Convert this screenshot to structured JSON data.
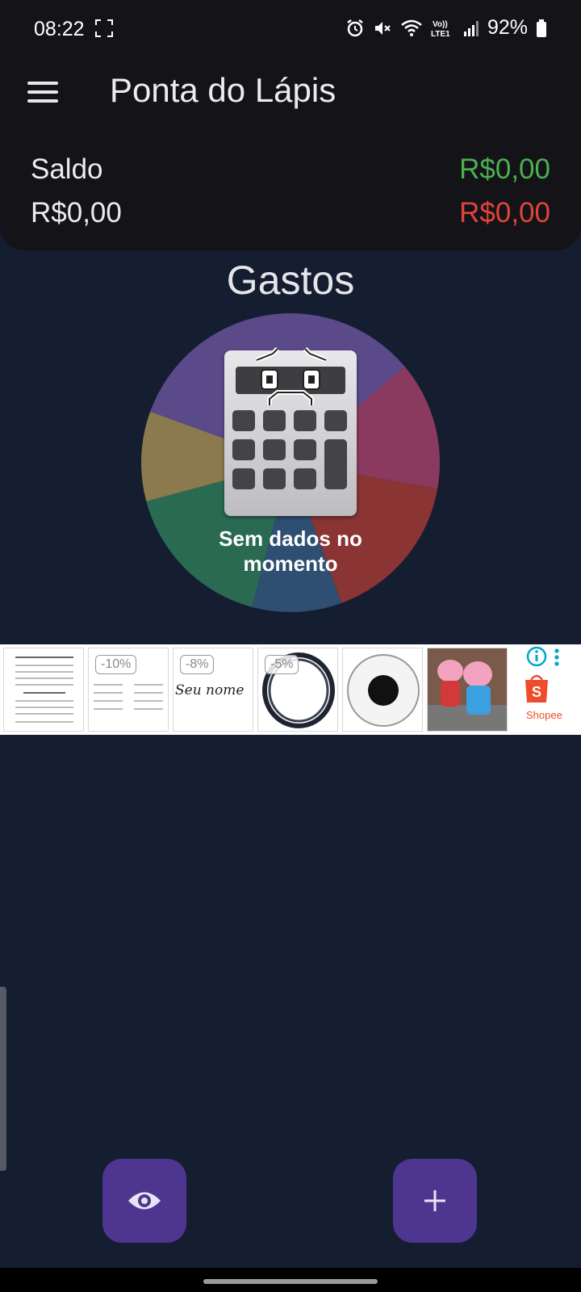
{
  "status_bar": {
    "time": "08:22",
    "network_label": "Vo)) LTE1",
    "battery": "92%"
  },
  "app": {
    "title": "Ponta do Lápis",
    "menu_icon": "hamburger-menu-icon"
  },
  "balance": {
    "label": "Saldo",
    "value": "R$0,00",
    "income": "R$0,00",
    "expense": "R$0,00",
    "income_color": "#4caf50",
    "expense_color": "#e0443a"
  },
  "chart": {
    "title": "Gastos",
    "empty_message": "Sem dados no momento",
    "placeholder_icon": "sad-calculator-icon",
    "slice_colors": [
      "#5a4a8a",
      "#8a3a5e",
      "#8a3434",
      "#2e4e72",
      "#2a6a52",
      "#8a7a4e"
    ]
  },
  "ad_banner": {
    "badges": [
      "-10%",
      "-8%",
      "-5%"
    ],
    "personalized_text": "Seu nome",
    "brand": "Shopee",
    "info_icon": "info-icon",
    "more_icon": "more-vertical-icon"
  },
  "fab": {
    "eye_icon": "eye-icon",
    "add_icon": "plus-icon"
  }
}
